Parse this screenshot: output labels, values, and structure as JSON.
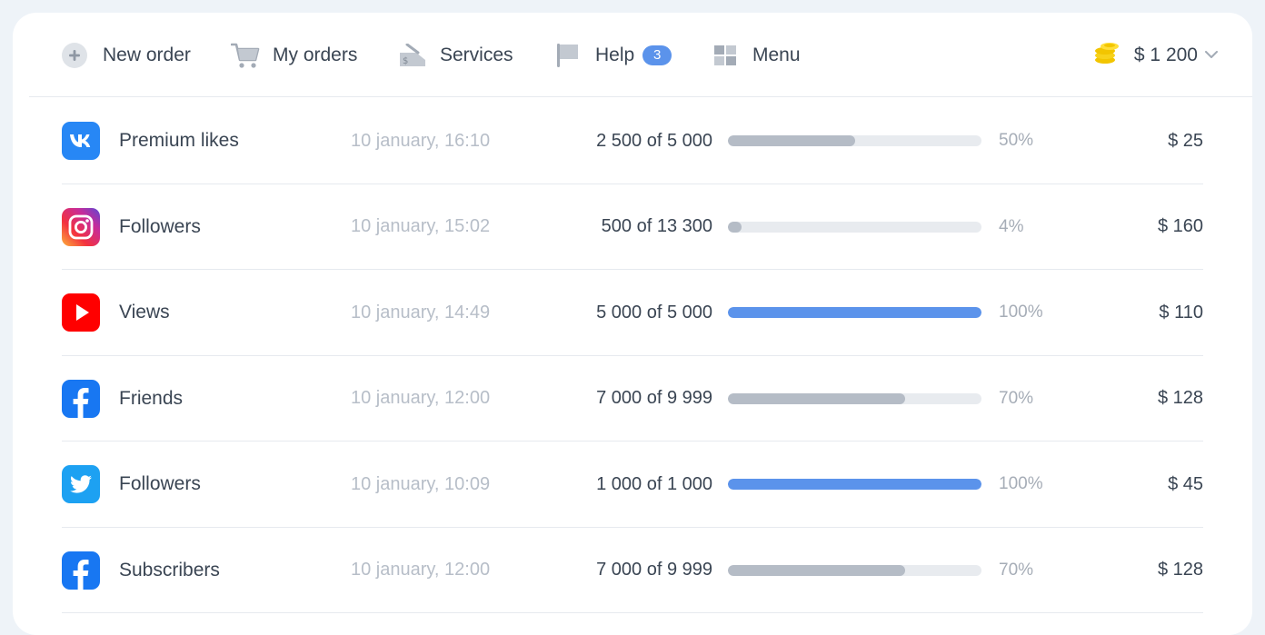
{
  "nav": {
    "new_order": {
      "label": "New order",
      "icon": "plus-circle-icon"
    },
    "my_orders": {
      "label": "My orders",
      "icon": "cart-icon"
    },
    "services": {
      "label": "Services",
      "icon": "price-tag-icon"
    },
    "help": {
      "label": "Help",
      "badge": "3",
      "icon": "flag-icon"
    },
    "menu": {
      "label": "Menu",
      "icon": "grid-icon"
    }
  },
  "balance": {
    "value": "$ 1 200",
    "icon": "coins-icon"
  },
  "colors": {
    "accent": "#5b93eb",
    "bar_partial": "#b5bcc6",
    "bar_track": "#e8ebef",
    "vk": "#2787f5",
    "youtube": "#ff0000",
    "facebook": "#1877f2",
    "twitter": "#1da1f2"
  },
  "orders": [
    {
      "service": "vk",
      "icon": "vk-icon",
      "name": "Premium likes",
      "date": "10 january, 16:10",
      "progress": "2 500 of 5 000",
      "fraction": 0.5,
      "percent": "50%",
      "price": "$ 25"
    },
    {
      "service": "instagram",
      "icon": "instagram-icon",
      "name": "Followers",
      "date": "10 january, 15:02",
      "progress": "500 of 13 300",
      "fraction": 0.04,
      "percent": "4%",
      "price": "$ 160"
    },
    {
      "service": "youtube",
      "icon": "youtube-icon",
      "name": "Views",
      "date": "10 january, 14:49",
      "progress": "5 000 of 5 000",
      "fraction": 1.0,
      "percent": "100%",
      "price": "$ 110"
    },
    {
      "service": "facebook",
      "icon": "facebook-icon",
      "name": "Friends",
      "date": "10 january, 12:00",
      "progress": "7 000 of 9 999",
      "fraction": 0.7,
      "percent": "70%",
      "price": "$ 128"
    },
    {
      "service": "twitter",
      "icon": "twitter-icon",
      "name": "Followers",
      "date": "10 january, 10:09",
      "progress": "1 000 of 1 000",
      "fraction": 1.0,
      "percent": "100%",
      "price": "$ 45"
    },
    {
      "service": "facebook",
      "icon": "facebook-icon",
      "name": "Subscribers",
      "date": "10 january, 12:00",
      "progress": "7 000 of 9 999",
      "fraction": 0.7,
      "percent": "70%",
      "price": "$ 128"
    }
  ]
}
